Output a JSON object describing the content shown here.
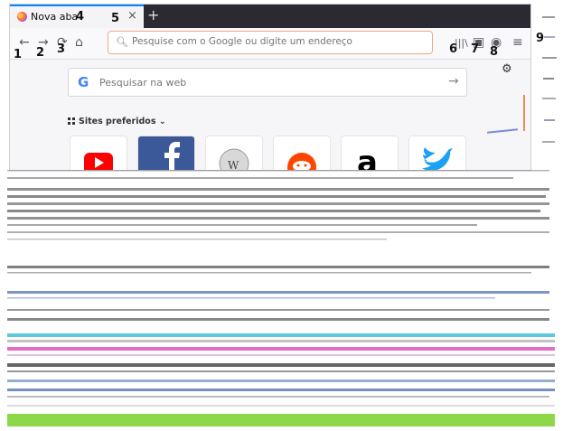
{
  "tab": {
    "title": "Nova aba",
    "close": "×",
    "new": "+"
  },
  "toolbar": {
    "back": "←",
    "forward": "→",
    "reload": "⟳",
    "home": "⌂",
    "url_placeholder": "Pesquise com o Google ou digite um endereço",
    "library": "|||\\",
    "sidebar": "▣",
    "account": "◉",
    "menu": "≡"
  },
  "newtab": {
    "search_placeholder": "Pesquisar na web",
    "search_logo": "G",
    "search_arrow": "→",
    "sites_heading": "Sites preferidos",
    "sites_chevron": "⌄",
    "gear": "⚙",
    "sites": [
      {
        "name": "youtube",
        "color": "#ff0000"
      },
      {
        "name": "facebook",
        "color": "#3b5998"
      },
      {
        "name": "wikipedia",
        "color": "#888888"
      },
      {
        "name": "reddit",
        "color": "#ff4500"
      },
      {
        "name": "amazon",
        "color": "#000000"
      },
      {
        "name": "twitter",
        "color": "#1da1f2"
      }
    ]
  },
  "callouts": [
    "1",
    "2",
    "3",
    "4",
    "5",
    "6",
    "7",
    "8",
    "9"
  ],
  "colors": {
    "accent": "#0a84ff",
    "tabbar": "#2b2a33",
    "url_border": "#f0a88a"
  }
}
